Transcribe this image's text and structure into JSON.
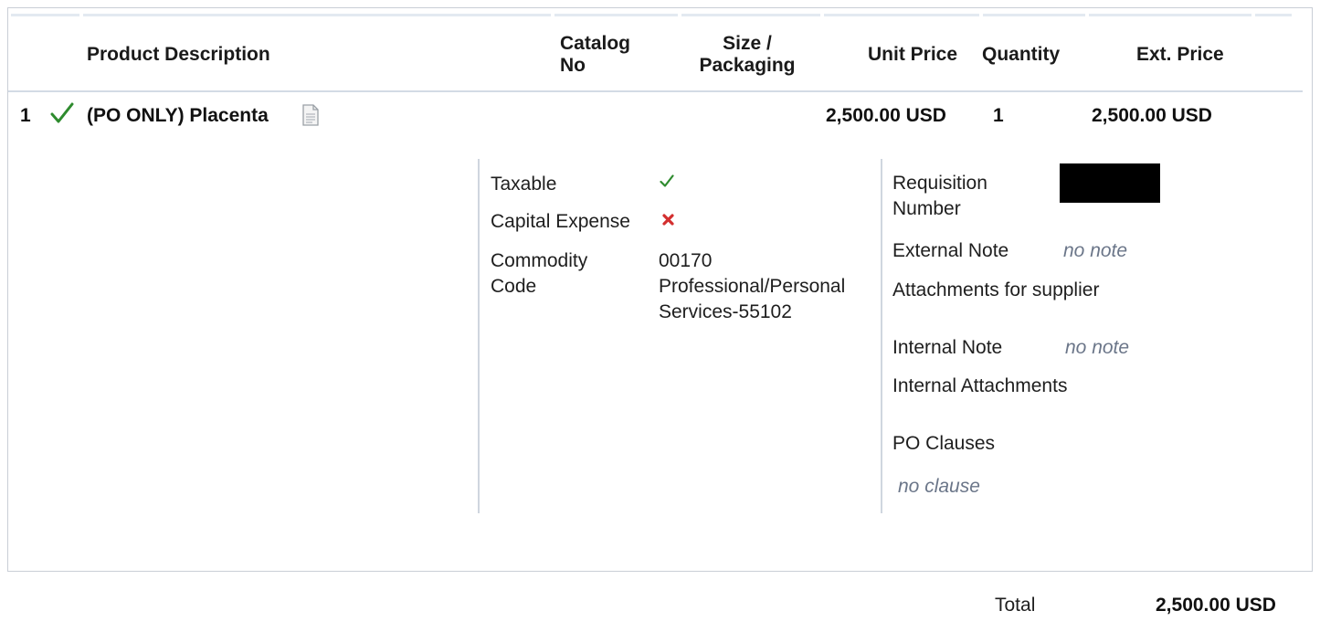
{
  "table": {
    "headers": {
      "product_description": "Product Description",
      "catalog_no_line1": "Catalog",
      "catalog_no_line2": "No",
      "size_line1": "Size /",
      "size_line2": "Packaging",
      "unit_price": "Unit Price",
      "quantity": "Quantity",
      "ext_price": "Ext. Price"
    },
    "rows": [
      {
        "line_no": "1",
        "description": "(PO ONLY) Placenta",
        "unit_price": "2,500.00 USD",
        "quantity": "1",
        "ext_price": "2,500.00 USD",
        "icons": {
          "status": "checkmark-icon",
          "document": "document-icon"
        }
      }
    ]
  },
  "details": {
    "taxable_label": "Taxable",
    "taxable_icon": "checkmark-icon",
    "capital_expense_label": "Capital Expense",
    "capital_expense_icon": "x-icon",
    "commodity_code_label_line1": "Commodity",
    "commodity_code_label_line2": "Code",
    "commodity_code_value_line1": "00170",
    "commodity_code_value_line2": "Professional/Personal",
    "commodity_code_value_line3": "Services-55102",
    "requisition_number_label_line1": "Requisition",
    "requisition_number_label_line2": "Number",
    "external_note_label": "External Note",
    "external_note_value": "no note",
    "attachments_supplier_label": "Attachments for supplier",
    "internal_note_label": "Internal Note",
    "internal_note_value": "no note",
    "internal_attachments_label": "Internal Attachments",
    "po_clauses_label": "PO Clauses",
    "po_clauses_value": "no clause"
  },
  "footer": {
    "total_label": "Total",
    "total_value": "2,500.00 USD"
  },
  "colors": {
    "check_green": "#2e8b2e",
    "x_red": "#d32f2f",
    "separator": "#d3dbe5",
    "muted_text": "#6b7689"
  }
}
